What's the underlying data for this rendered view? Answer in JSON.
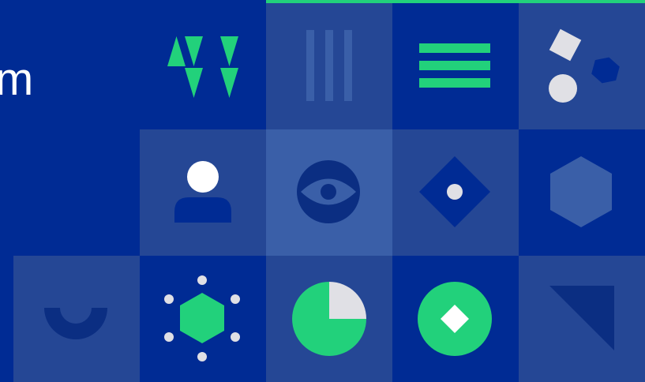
{
  "headline": {
    "fragment": "m"
  },
  "colors": {
    "background": "#002b94",
    "tile_mid": "#254795",
    "tile_light": "#3a5fa8",
    "accent_green": "#22d17b",
    "shape_light": "#e0e0e5",
    "shape_dark": "#0b2e82",
    "white": "#ffffff"
  },
  "icons": [
    "triangles-icon",
    "vertical-bars-icon",
    "horizontal-bars-icon",
    "shapes-icon",
    "person-icon",
    "eye-icon",
    "diamond-icon",
    "hexagon-icon",
    "smile-icon",
    "network-hexagon-icon",
    "pie-icon",
    "diamond-circle-icon",
    "triangle-corner-icon"
  ]
}
